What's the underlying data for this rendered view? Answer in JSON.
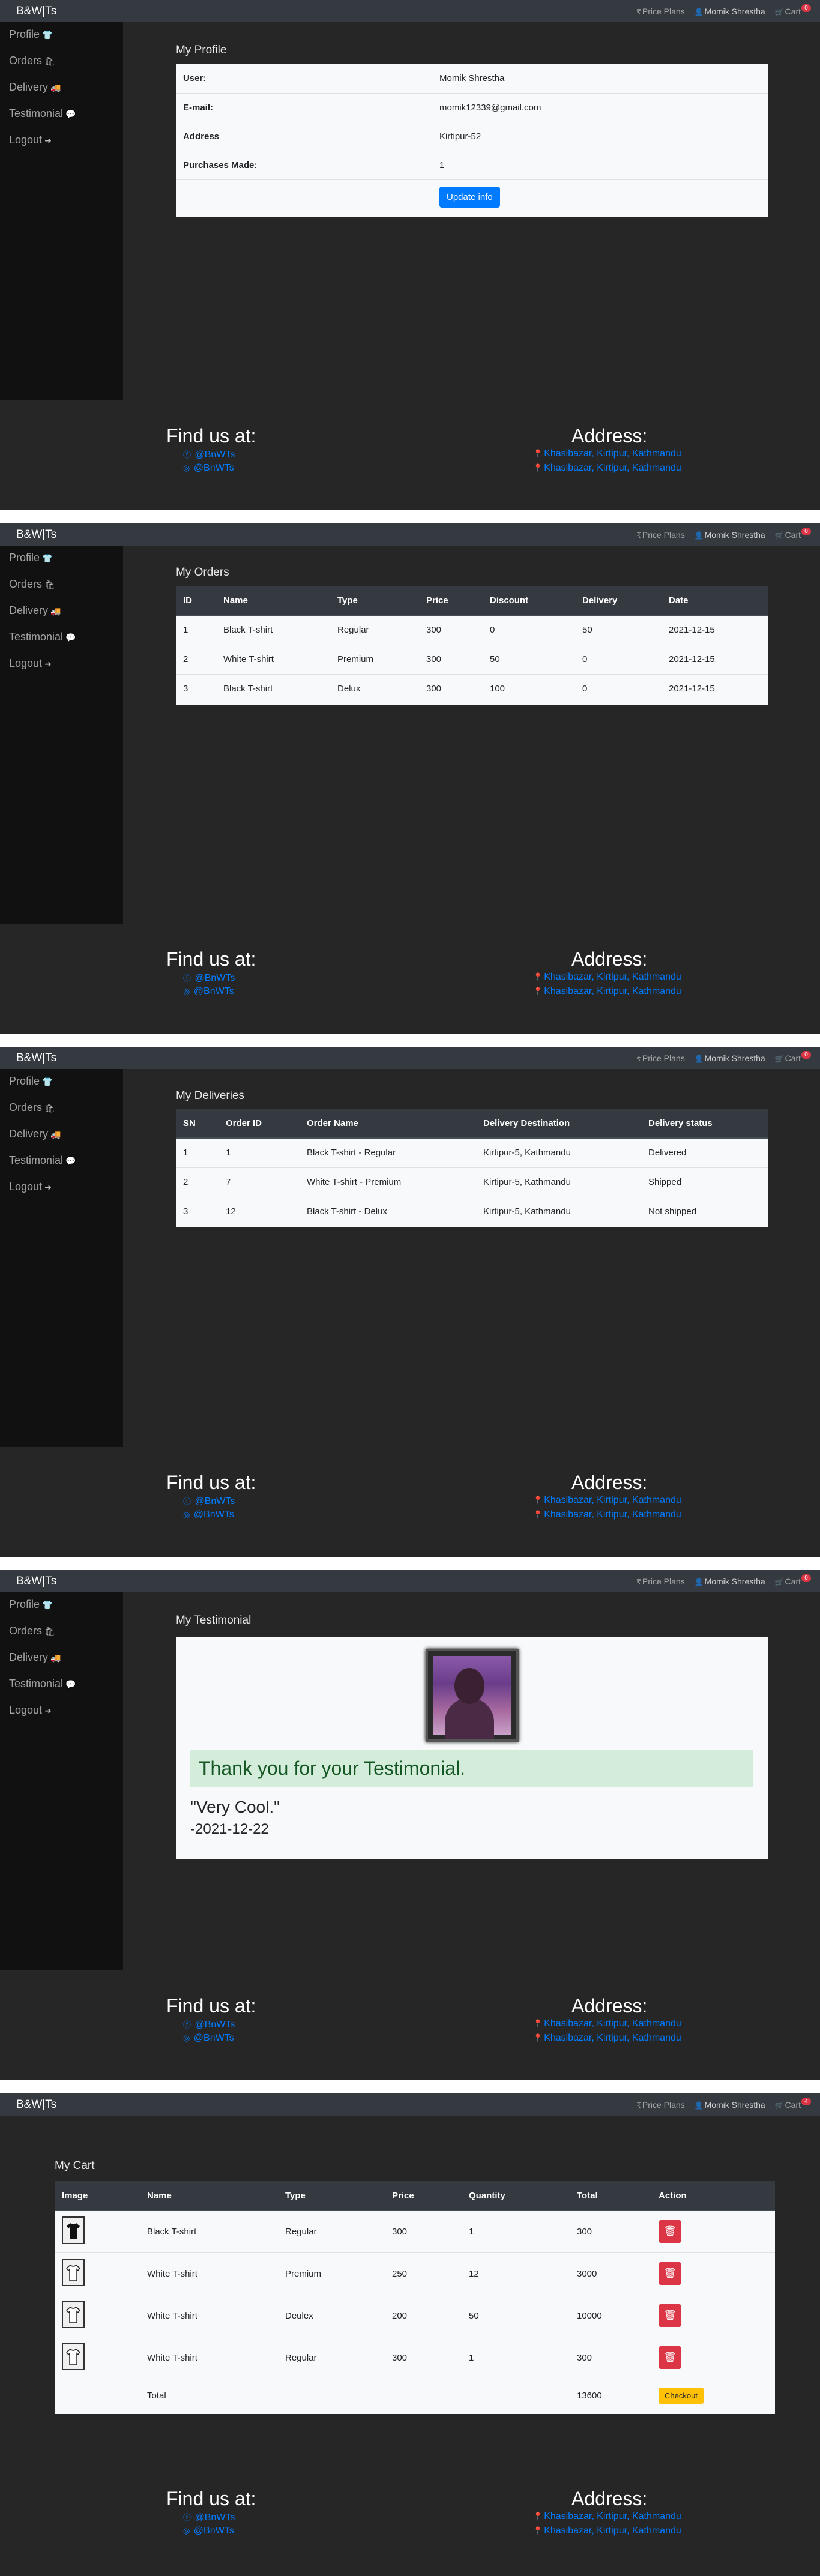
{
  "navbar": {
    "brand": "B&W|Ts",
    "price_plans": "Price Plans",
    "user": "Momik Shrestha",
    "cart": "Cart",
    "cart_badge_empty": "0",
    "cart_badge_full": "4"
  },
  "sidebar": {
    "items": [
      {
        "label": "Profile",
        "icon": "tshirt-icon"
      },
      {
        "label": "Orders",
        "icon": "orders-icon"
      },
      {
        "label": "Delivery",
        "icon": "truck-icon"
      },
      {
        "label": "Testimonial",
        "icon": "comment-icon"
      },
      {
        "label": "Logout",
        "icon": "logout-icon"
      }
    ]
  },
  "footer": {
    "find_heading": "Find us at:",
    "address_heading": "Address:",
    "facebook": "@BnWTs",
    "instagram": "@BnWTs",
    "address_1": "Khasibazar, Kirtipur, Kathmandu",
    "address_2": "Khasibazar, Kirtipur, Kathmandu"
  },
  "profile": {
    "title": "My Profile",
    "rows": [
      {
        "key": "User:",
        "value": "Momik Shrestha"
      },
      {
        "key": "E-mail:",
        "value": "momik12339@gmail.com"
      },
      {
        "key": "Address",
        "value": "Kirtipur-52"
      },
      {
        "key": "Purchases Made:",
        "value": "1"
      }
    ],
    "update_button": "Update info"
  },
  "orders": {
    "title": "My Orders",
    "headers": [
      "ID",
      "Name",
      "Type",
      "Price",
      "Discount",
      "Delivery",
      "Date"
    ],
    "rows": [
      [
        "1",
        "Black T-shirt",
        "Regular",
        "300",
        "0",
        "50",
        "2021-12-15"
      ],
      [
        "2",
        "White T-shirt",
        "Premium",
        "300",
        "50",
        "0",
        "2021-12-15"
      ],
      [
        "3",
        "Black T-shirt",
        "Delux",
        "300",
        "100",
        "0",
        "2021-12-15"
      ]
    ]
  },
  "deliveries": {
    "title": "My Deliveries",
    "headers": [
      "SN",
      "Order ID",
      "Order Name",
      "Delivery Destination",
      "Delivery status"
    ],
    "rows": [
      [
        "1",
        "1",
        "Black T-shirt - Regular",
        "Kirtipur-5, Kathmandu",
        "Delivered"
      ],
      [
        "2",
        "7",
        "White T-shirt - Premium",
        "Kirtipur-5, Kathmandu",
        "Shipped"
      ],
      [
        "3",
        "12",
        "Black T-shirt - Delux",
        "Kirtipur-5, Kathmandu",
        "Not shipped"
      ]
    ]
  },
  "testimonial": {
    "title": "My Testimonial",
    "thanks": "Thank you for your Testimonial.",
    "quote": "\"Very Cool.\"",
    "date": "-2021-12-22"
  },
  "cart": {
    "title": "My Cart",
    "headers": [
      "Image",
      "Name",
      "Type",
      "Price",
      "Quantity",
      "Total",
      "Action"
    ],
    "rows": [
      {
        "color": "black",
        "name": "Black T-shirt",
        "type": "Regular",
        "price": "300",
        "quantity": "1",
        "total": "300"
      },
      {
        "color": "white",
        "name": "White T-shirt",
        "type": "Premium",
        "price": "250",
        "quantity": "12",
        "total": "3000"
      },
      {
        "color": "white",
        "name": "White T-shirt",
        "type": "Deulex",
        "price": "200",
        "quantity": "50",
        "total": "10000"
      },
      {
        "color": "white",
        "name": "White T-shirt",
        "type": "Regular",
        "price": "300",
        "quantity": "1",
        "total": "300"
      }
    ],
    "total_label": "Total",
    "grand_total": "13600",
    "checkout_button": "Checkout"
  }
}
